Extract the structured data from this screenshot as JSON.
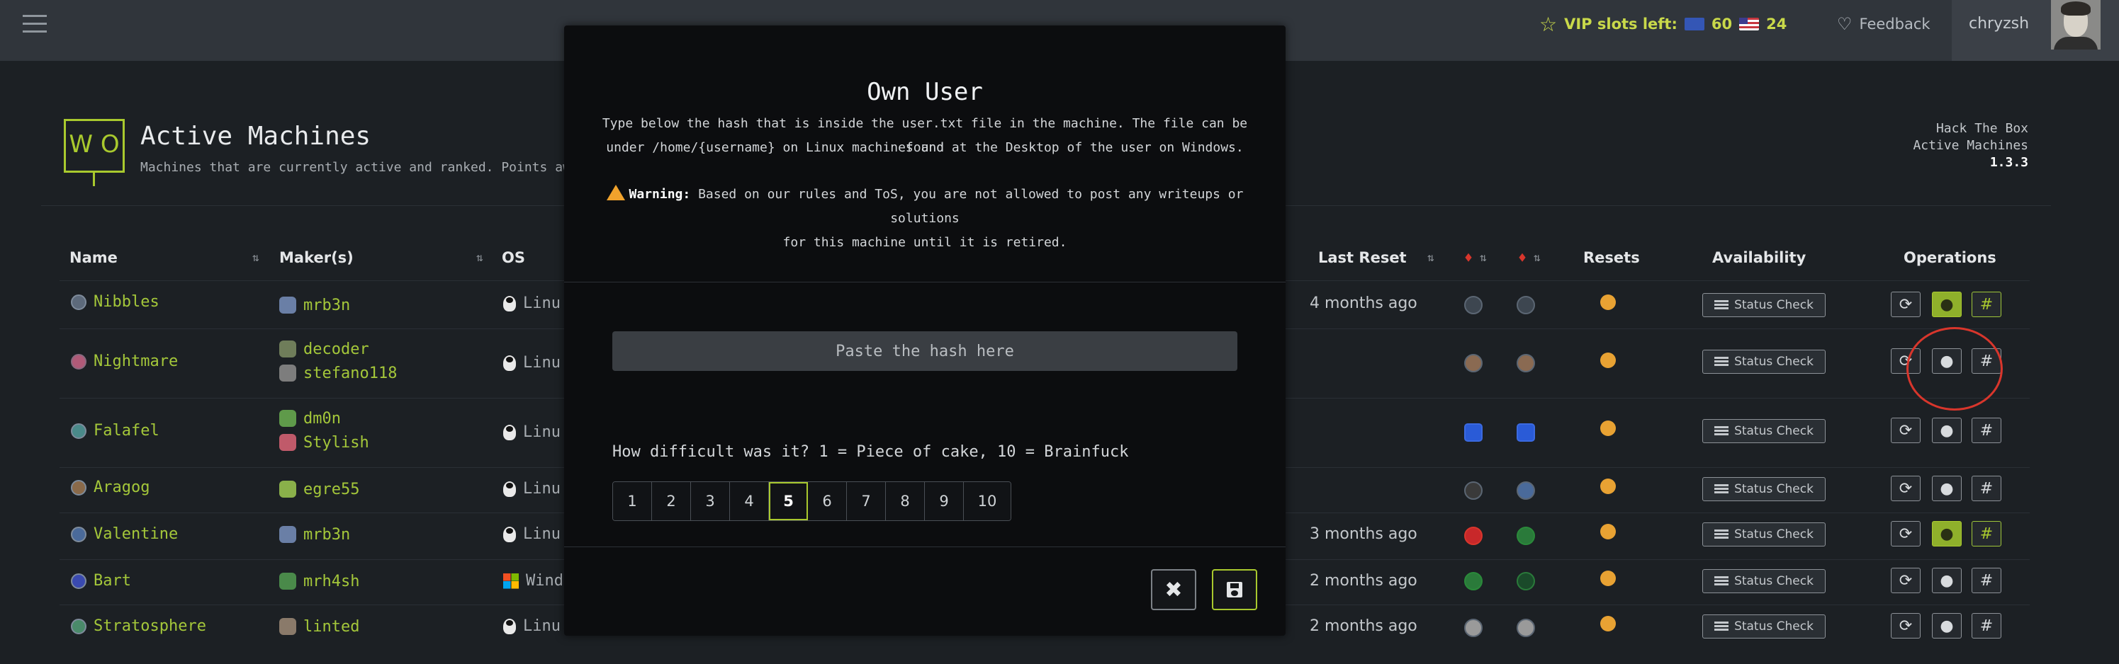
{
  "topbar": {
    "vip_label": "VIP slots left:",
    "eu_slots": "60",
    "us_slots": "24",
    "feedback": "Feedback",
    "username": "chryzsh"
  },
  "header": {
    "logo_text": "W O",
    "title": "Active Machines",
    "subtitle": "Machines that are currently active and ranked. Points awarde",
    "app_name": "Hack The Box",
    "app_section": "Active Machines",
    "version": "1.3.3"
  },
  "table": {
    "columns": {
      "name": "Name",
      "makers": "Maker(s)",
      "os": "OS",
      "last_reset": "Last Reset",
      "resets": "Resets",
      "availability": "Availability",
      "operations": "Operations"
    },
    "status_label": "Status Check",
    "rows": [
      {
        "name": "Nibbles",
        "makers": [
          "mrb3n"
        ],
        "os": "Linu",
        "last_reset": "4 months ago"
      },
      {
        "name": "Nightmare",
        "makers": [
          "decoder",
          "stefano118"
        ],
        "os": "Linu",
        "last_reset": ""
      },
      {
        "name": "Falafel",
        "makers": [
          "dm0n",
          "Stylish"
        ],
        "os": "Linu",
        "last_reset": ""
      },
      {
        "name": "Aragog",
        "makers": [
          "egre55"
        ],
        "os": "Linu",
        "last_reset": ""
      },
      {
        "name": "Valentine",
        "makers": [
          "mrb3n"
        ],
        "os": "Linu",
        "last_reset": "3 months ago"
      },
      {
        "name": "Bart",
        "makers": [
          "mrh4sh"
        ],
        "os": "Windo",
        "last_reset": "2 months ago"
      },
      {
        "name": "Stratosphere",
        "makers": [
          "linted"
        ],
        "os": "Linu",
        "last_reset": "2 months ago"
      }
    ]
  },
  "modal": {
    "title": "Own User",
    "desc_line1": "Type below the hash that is inside the user.txt file in the machine. The file can be found",
    "desc_line2": "under /home/{username} on Linux machines and at the Desktop of the user on Windows.",
    "warning_label": "Warning:",
    "warning_line1": "Based on our rules and ToS, you are not allowed to post any writeups or solutions",
    "warning_line2": "for this machine until it is retired.",
    "hash_placeholder": "Paste the hash here",
    "difficulty_label": "How difficult was it? 1 = Piece of cake, 10 = Brainfuck",
    "difficulty_options": [
      "1",
      "2",
      "3",
      "4",
      "5",
      "6",
      "7",
      "8",
      "9",
      "10"
    ],
    "difficulty_selected": "5"
  },
  "colors": {
    "accent": "#a9c92e",
    "topbar": "#30353b",
    "background": "#1c2024",
    "modal": "#0c0d0f",
    "annotation": "#d8362c"
  },
  "icons": [
    "hamburger-icon",
    "star-icon",
    "lightbulb-icon",
    "linux-icon",
    "windows-icon",
    "refresh-icon",
    "user-icon",
    "hash-icon",
    "close-icon",
    "save-icon",
    "warning-icon"
  ]
}
